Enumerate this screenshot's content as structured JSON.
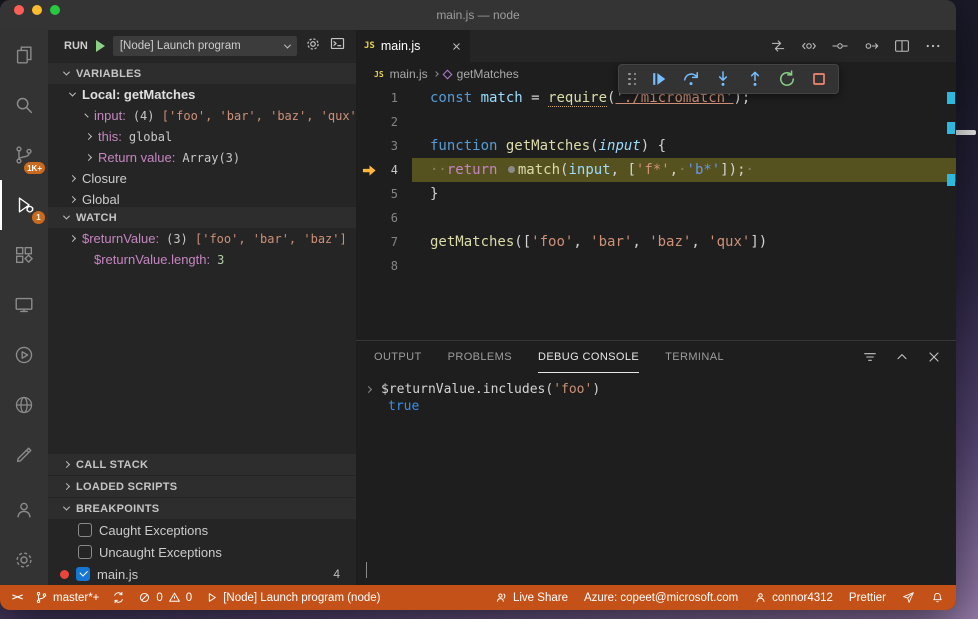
{
  "colors": {
    "status_bar_debugging": "#c45218",
    "debug_line_highlight": "#55521f",
    "activity_badge": "#c96a1e",
    "breakpoint_red": "#e8463c",
    "step_icon_blue": "#75beff",
    "restart_green": "#89d185",
    "stop_red": "#f48771"
  },
  "window": {
    "title": "main.js — node"
  },
  "activity_bar": {
    "source_control_badge": "1K+",
    "debug_badge": "1"
  },
  "run_bar": {
    "run_label": "RUN",
    "config": "[Node] Launch program"
  },
  "sections": {
    "variables": "VARIABLES",
    "watch": "WATCH",
    "call_stack": "CALL STACK",
    "loaded_scripts": "LOADED SCRIPTS",
    "breakpoints": "BREAKPOINTS"
  },
  "variables": {
    "scope": "Local: getMatches",
    "input_name": "input:",
    "input_count": "(4) ",
    "input_value": "['foo', 'bar', 'baz', 'qux']",
    "this_name": "this:",
    "this_value": "global",
    "return_name": "Return value:",
    "return_value": "Array(3)",
    "closure": "Closure",
    "global": "Global"
  },
  "watch": {
    "rv_name": "$returnValue:",
    "rv_count": "(3) ",
    "rv_value": "['foo', 'bar', 'baz']",
    "len_name": "$returnValue.length:",
    "len_value": "3"
  },
  "breakpoints": {
    "caught": "Caught Exceptions",
    "uncaught": "Uncaught Exceptions",
    "file": "main.js",
    "line": "4"
  },
  "editor": {
    "js_icon": "JS",
    "tab": "main.js",
    "crumb_file": "main.js",
    "crumb_symbol": "getMatches",
    "line_numbers": [
      "1",
      "2",
      "3",
      "4",
      "5",
      "6",
      "7",
      "8"
    ],
    "code": {
      "l1": {
        "kw": "const ",
        "var": "match",
        "op": " = ",
        "fn": "require",
        "p1": "(",
        "str": "'./micromatch'",
        "p2": ");"
      },
      "l3": {
        "kw": "function ",
        "fn": "getMatches",
        "p1": "(",
        "param": "input",
        "p2": ") {"
      },
      "l4": {
        "ws1": "··",
        "kw": "return",
        "sp": " ",
        "fn": "match",
        "p1": "(",
        "var": "input",
        "p2": ", [",
        "s1": "'f*'",
        "c": ",",
        "ws2": "·",
        "s2": "'b*'",
        "p3": "]);",
        "ws3": "·"
      },
      "l5": {
        "p": "}"
      },
      "l7": {
        "fn": "getMatches",
        "p1": "([",
        "s1": "'foo'",
        "c1": ", ",
        "s2": "'bar'",
        "c2": ", ",
        "s3": "'baz'",
        "c3": ", ",
        "s4": "'qux'",
        "p2": "])"
      }
    }
  },
  "panel": {
    "tabs": {
      "output": "OUTPUT",
      "problems": "PROBLEMS",
      "debug_console": "DEBUG CONSOLE",
      "terminal": "TERMINAL"
    },
    "console": {
      "expr_pre": "$returnValue.includes(",
      "expr_str": "'foo'",
      "expr_post": ")",
      "result": "true"
    }
  },
  "status_bar": {
    "remote": "><",
    "branch": "master*+",
    "errors": "0",
    "warnings": "0",
    "debug_target": "[Node] Launch program (node)",
    "live_share": "Live Share",
    "azure": "Azure: copeet@microsoft.com",
    "account": "connor4312",
    "formatter": "Prettier"
  }
}
